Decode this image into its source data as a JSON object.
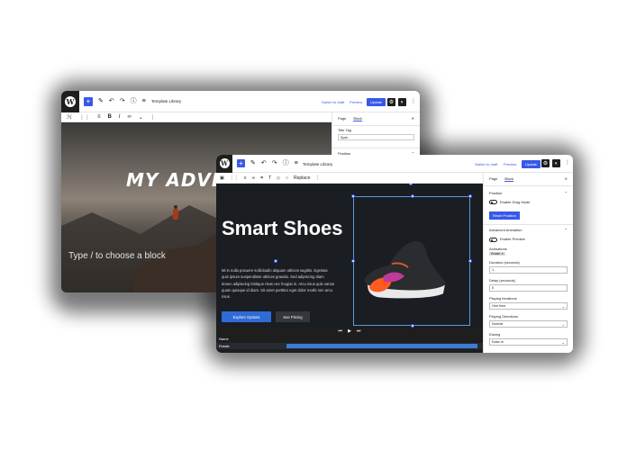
{
  "back_window": {
    "title": "Template Library",
    "switch_to_draft": "Switch to draft",
    "preview": "Preview",
    "update": "Update",
    "sidebar_tabs": [
      "Page",
      "Block"
    ],
    "title_tag_label": "Title Tag",
    "title_tag_value": "Span",
    "position_label": "Position",
    "hero_heading": "MY ADVEN",
    "placeholder": "Type / to choose a block"
  },
  "front_window": {
    "title": "Template Library",
    "switch_to_draft": "Switch to draft",
    "preview": "Preview",
    "update": "Update",
    "replace": "Replace",
    "heading": "Smart Shoes",
    "description": "Mi in nulla posuere sollicitudin aliquam ultrices sagittis. Egestas quis ipsum suspendisse ultrices gravida. Sed adipiscing diam donec adipiscing tristique risus nec feugiat in. Arcu risus quis varius quam quisque id diam. Sit amet porttitor eget dolor morbi non arcu risus.",
    "btn_primary": "Explore Options",
    "btn_secondary": "See Pricing",
    "timeline_rows": [
      "Name",
      "Rotate"
    ],
    "sidebar": {
      "tabs": [
        "Page",
        "Block"
      ],
      "position": "Position",
      "enable_drag": "Enable Drag Mode",
      "reset_position": "Reset Position",
      "advanced_animation": "Advanced Animation",
      "enable_preview": "Enable Preview",
      "animations": "Animations",
      "animation_tag": "Rotate",
      "duration_label": "Duration (seconds)",
      "duration_value": "1",
      "delay_label": "Delay (seconds)",
      "delay_value": "0",
      "playing_iterations_label": "Playing Iterations",
      "playing_iterations_value": "One time",
      "playing_directions_label": "Playing Directions",
      "playing_directions_value": "Normal",
      "easing_label": "Easing",
      "easing_value": "Ease-in"
    }
  },
  "colors": {
    "accent": "#3858e9",
    "canvas_dark": "#1a1d22",
    "button_blue": "#2e6bd6"
  }
}
